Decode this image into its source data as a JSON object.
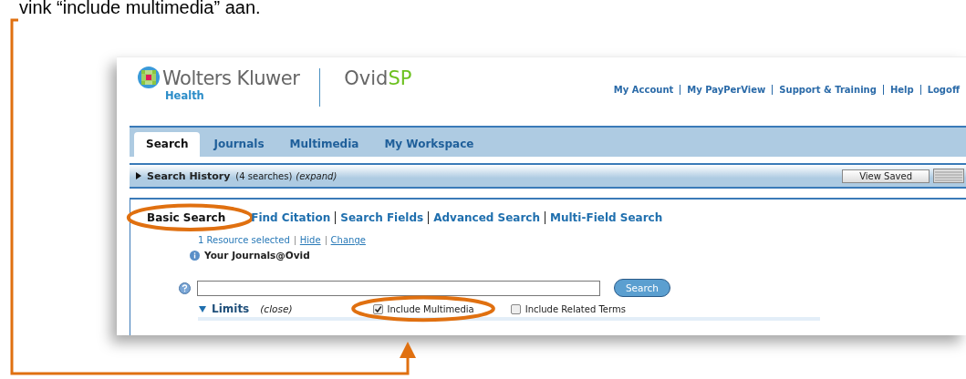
{
  "caption": "vink “include multimedia” aan.",
  "brand": {
    "name": "Wolters Kluwer",
    "division": "Health",
    "product": "Ovid",
    "product_suffix": "SP"
  },
  "top_links": [
    "My Account",
    "My PayPerView",
    "Support & Training",
    "Help",
    "Logoff"
  ],
  "tabs": [
    {
      "label": "Search",
      "selected": true
    },
    {
      "label": "Journals",
      "selected": false
    },
    {
      "label": "Multimedia",
      "selected": false
    },
    {
      "label": "My Workspace",
      "selected": false
    }
  ],
  "history": {
    "title": "Search History",
    "count": "(4 searches)",
    "toggle": "(expand)",
    "expanded": false,
    "button": "View Saved"
  },
  "search_modes": [
    {
      "label": "Basic Search",
      "selected": true
    },
    {
      "label": "Find Citation",
      "selected": false
    },
    {
      "label": "Search Fields",
      "selected": false
    },
    {
      "label": "Advanced Search",
      "selected": false
    },
    {
      "label": "Multi-Field Search",
      "selected": false
    }
  ],
  "resources": {
    "summary": "1 Resource selected",
    "hide": "Hide",
    "change": "Change",
    "name": "Your Journals@Ovid"
  },
  "search_button": "Search",
  "limits": {
    "label": "Limits",
    "toggle": "(close)",
    "expanded": true
  },
  "options": [
    {
      "label": "Include Multimedia",
      "checked": true
    },
    {
      "label": "Include Related Terms",
      "checked": false
    }
  ]
}
